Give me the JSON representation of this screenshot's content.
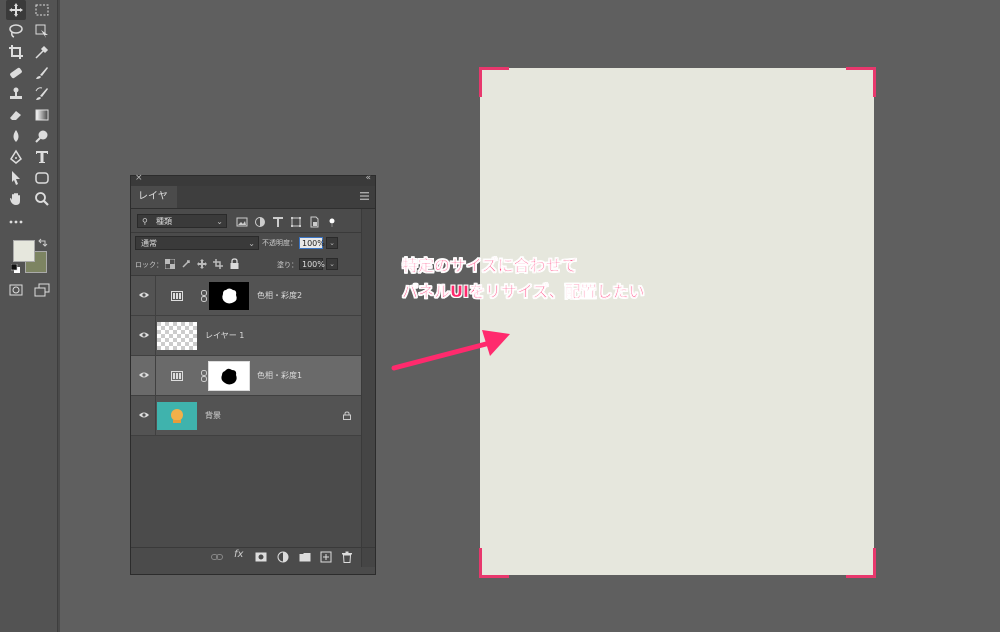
{
  "layers_panel": {
    "tab_label": "レイヤー",
    "filter_kind": "種類",
    "blend_mode": "通常",
    "opacity_label": "不透明度：",
    "opacity_value": "100%",
    "lock_label": "ロック：",
    "fill_label": "塗り：",
    "fill_value": "100%",
    "layers": [
      {
        "name": "色相・彩度2",
        "type": "adjustment",
        "selected": false,
        "locked": false
      },
      {
        "name": "レイヤー 1",
        "type": "transparent",
        "selected": false,
        "locked": false
      },
      {
        "name": "色相・彩度1",
        "type": "adjustment",
        "selected": true,
        "locked": false
      },
      {
        "name": "背景",
        "type": "image",
        "selected": false,
        "locked": true
      }
    ],
    "bottom_fx": "fx"
  },
  "annotation": {
    "line1": "特定のサイズに合わせて",
    "line2": "パネルUIをリサイズ、配置したい",
    "color": "#ff2a6d"
  },
  "colors": {
    "workspace": "#5f5f5f",
    "canvas": "#e6e7dd",
    "foreground_swatch": "#e6e7dd",
    "background_swatch": "#7d8462",
    "corner_marks": "#e8386d"
  }
}
